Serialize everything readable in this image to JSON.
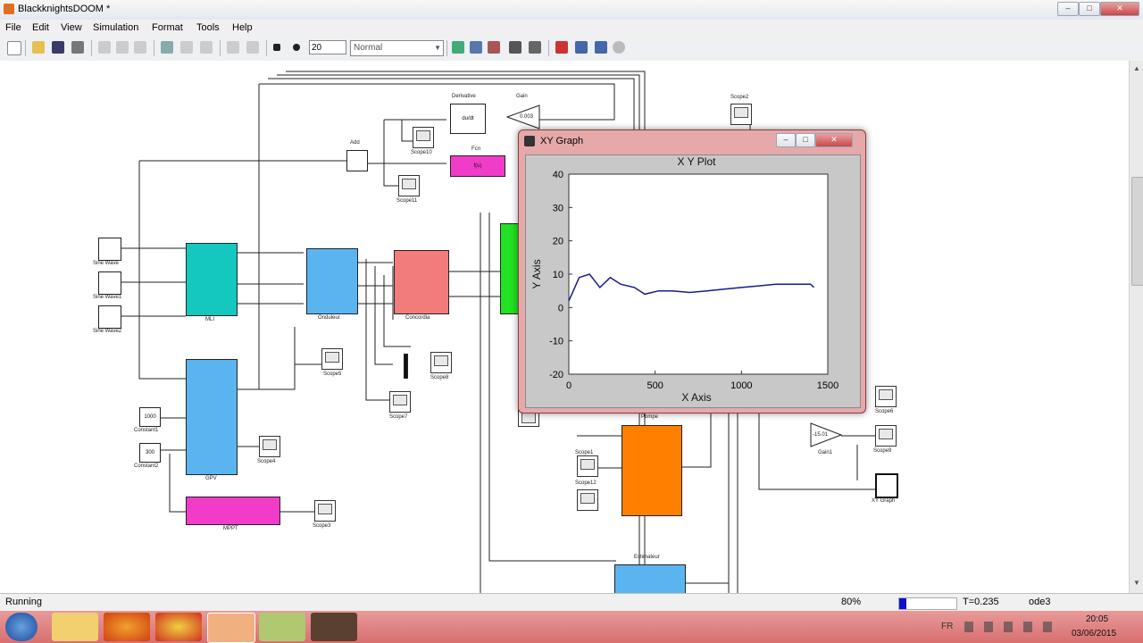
{
  "window": {
    "title": "BlackknightsDOOM *"
  },
  "menu": [
    "File",
    "Edit",
    "View",
    "Simulation",
    "Format",
    "Tools",
    "Help"
  ],
  "toolbar": {
    "stop_time": "20",
    "mode": "Normal"
  },
  "blocks": {
    "mli": "MLI",
    "onduleur": "Onduleur",
    "concordia": "Concordia",
    "gpv": "GPV",
    "mppt": "MPPT",
    "derivative": "Derivative",
    "derivative_text": "du/dt",
    "gain": "Gain",
    "gain_value": "0.003",
    "fcn": "Fcn",
    "fcn_text": "f(u)",
    "add": "Add",
    "pompe": "Pompe",
    "estimateur": "Estimateur",
    "xy_graph": "XY Graph",
    "gain1": "Gain1",
    "gain1_value": "-15.01",
    "sine1": "Sine Wave",
    "sine2": "Sine Wave1",
    "sine3": "Sine Wave2",
    "const1": "Constant1",
    "const1_value": "1000",
    "const2": "Constant2",
    "const2_value": "300",
    "scope1": "Scope1",
    "scope2": "Scope2",
    "scope3": "Scope3",
    "scope4": "Scope4",
    "scope5": "Scope5",
    "scope6": "Scope6",
    "scope7": "Scope7",
    "scope8": "Scope8",
    "scope9": "Scope9",
    "scope10": "Scope10",
    "scope11": "Scope11",
    "scope12": "Scope12"
  },
  "xy_window": {
    "title": "XY Graph"
  },
  "chart_data": {
    "type": "line",
    "title": "X Y Plot",
    "xlabel": "X Axis",
    "ylabel": "Y Axis",
    "xlim": [
      0,
      1500
    ],
    "ylim": [
      -20,
      40
    ],
    "xticks": [
      0,
      500,
      1000,
      1500
    ],
    "yticks": [
      40,
      30,
      20,
      10,
      0,
      -10,
      -20
    ],
    "grid": false,
    "series": [
      {
        "color": "#1a1a8c",
        "x": [
          0,
          60,
          120,
          180,
          240,
          300,
          380,
          440,
          520,
          600,
          700,
          800,
          900,
          1000,
          1100,
          1200,
          1300,
          1400,
          1420
        ],
        "y": [
          2,
          9,
          10,
          6,
          9,
          7,
          6,
          4,
          5,
          5,
          4.5,
          5,
          5.5,
          6,
          6.5,
          7,
          7,
          7,
          6
        ]
      }
    ]
  },
  "status": {
    "state": "Running",
    "zoom": "80%",
    "time": "T=0.235",
    "solver": "ode3"
  },
  "taskbar": {
    "lang": "FR",
    "clock_time": "20:05",
    "clock_date": "03/06/2015"
  }
}
